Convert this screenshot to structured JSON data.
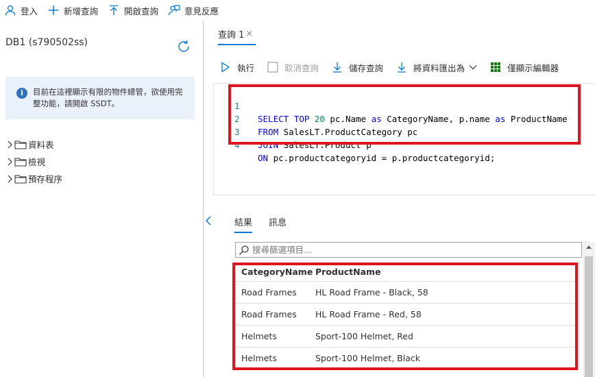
{
  "toolbar": {
    "login": "登入",
    "new_query": "新增查詢",
    "open_query": "開啟查詢",
    "feedback": "意見反應"
  },
  "sidebar": {
    "db_name": "DB1 (s790502ss)",
    "info_text": "目前在這裡顯示有限的物件總管，欲使用完整功能，請開啟 SSDT。",
    "tree": [
      {
        "label": "資料表"
      },
      {
        "label": "檢視"
      },
      {
        "label": "預存程序"
      }
    ]
  },
  "editor": {
    "tab_label": "查詢 1",
    "tab_close": "×",
    "actions": {
      "run": "執行",
      "cancel": "取消查詢",
      "save": "儲存查詢",
      "export": "將資料匯出為",
      "show_editor_only": "僅顯示編輯器"
    },
    "code": [
      {
        "ln": "1",
        "text": "SELECT TOP 20 pc.Name as CategoryName, p.name as ProductName"
      },
      {
        "ln": "2",
        "text": "FROM SalesLT.ProductCategory pc"
      },
      {
        "ln": "3",
        "text": "JOIN SalesLT.Product p"
      },
      {
        "ln": "4",
        "text": "ON pc.productcategoryid = p.productcategoryid;"
      }
    ]
  },
  "results": {
    "tabs": [
      "結果",
      "訊息"
    ],
    "filter_placeholder": "搜尋篩選項目...",
    "columns": [
      "CategoryName",
      "ProductName"
    ],
    "rows": [
      [
        "Road Frames",
        "HL Road Frame - Black, 58"
      ],
      [
        "Road Frames",
        "HL Road Frame - Red, 58"
      ],
      [
        "Helmets",
        "Sport-100 Helmet, Red"
      ],
      [
        "Helmets",
        "Sport-100 Helmet, Black"
      ]
    ]
  },
  "colors": {
    "accent": "#0078d4",
    "highlight_border": "#e0141e",
    "keyword": "#0000ff",
    "line_number": "#237893",
    "info_bg": "#eaf1fb"
  }
}
